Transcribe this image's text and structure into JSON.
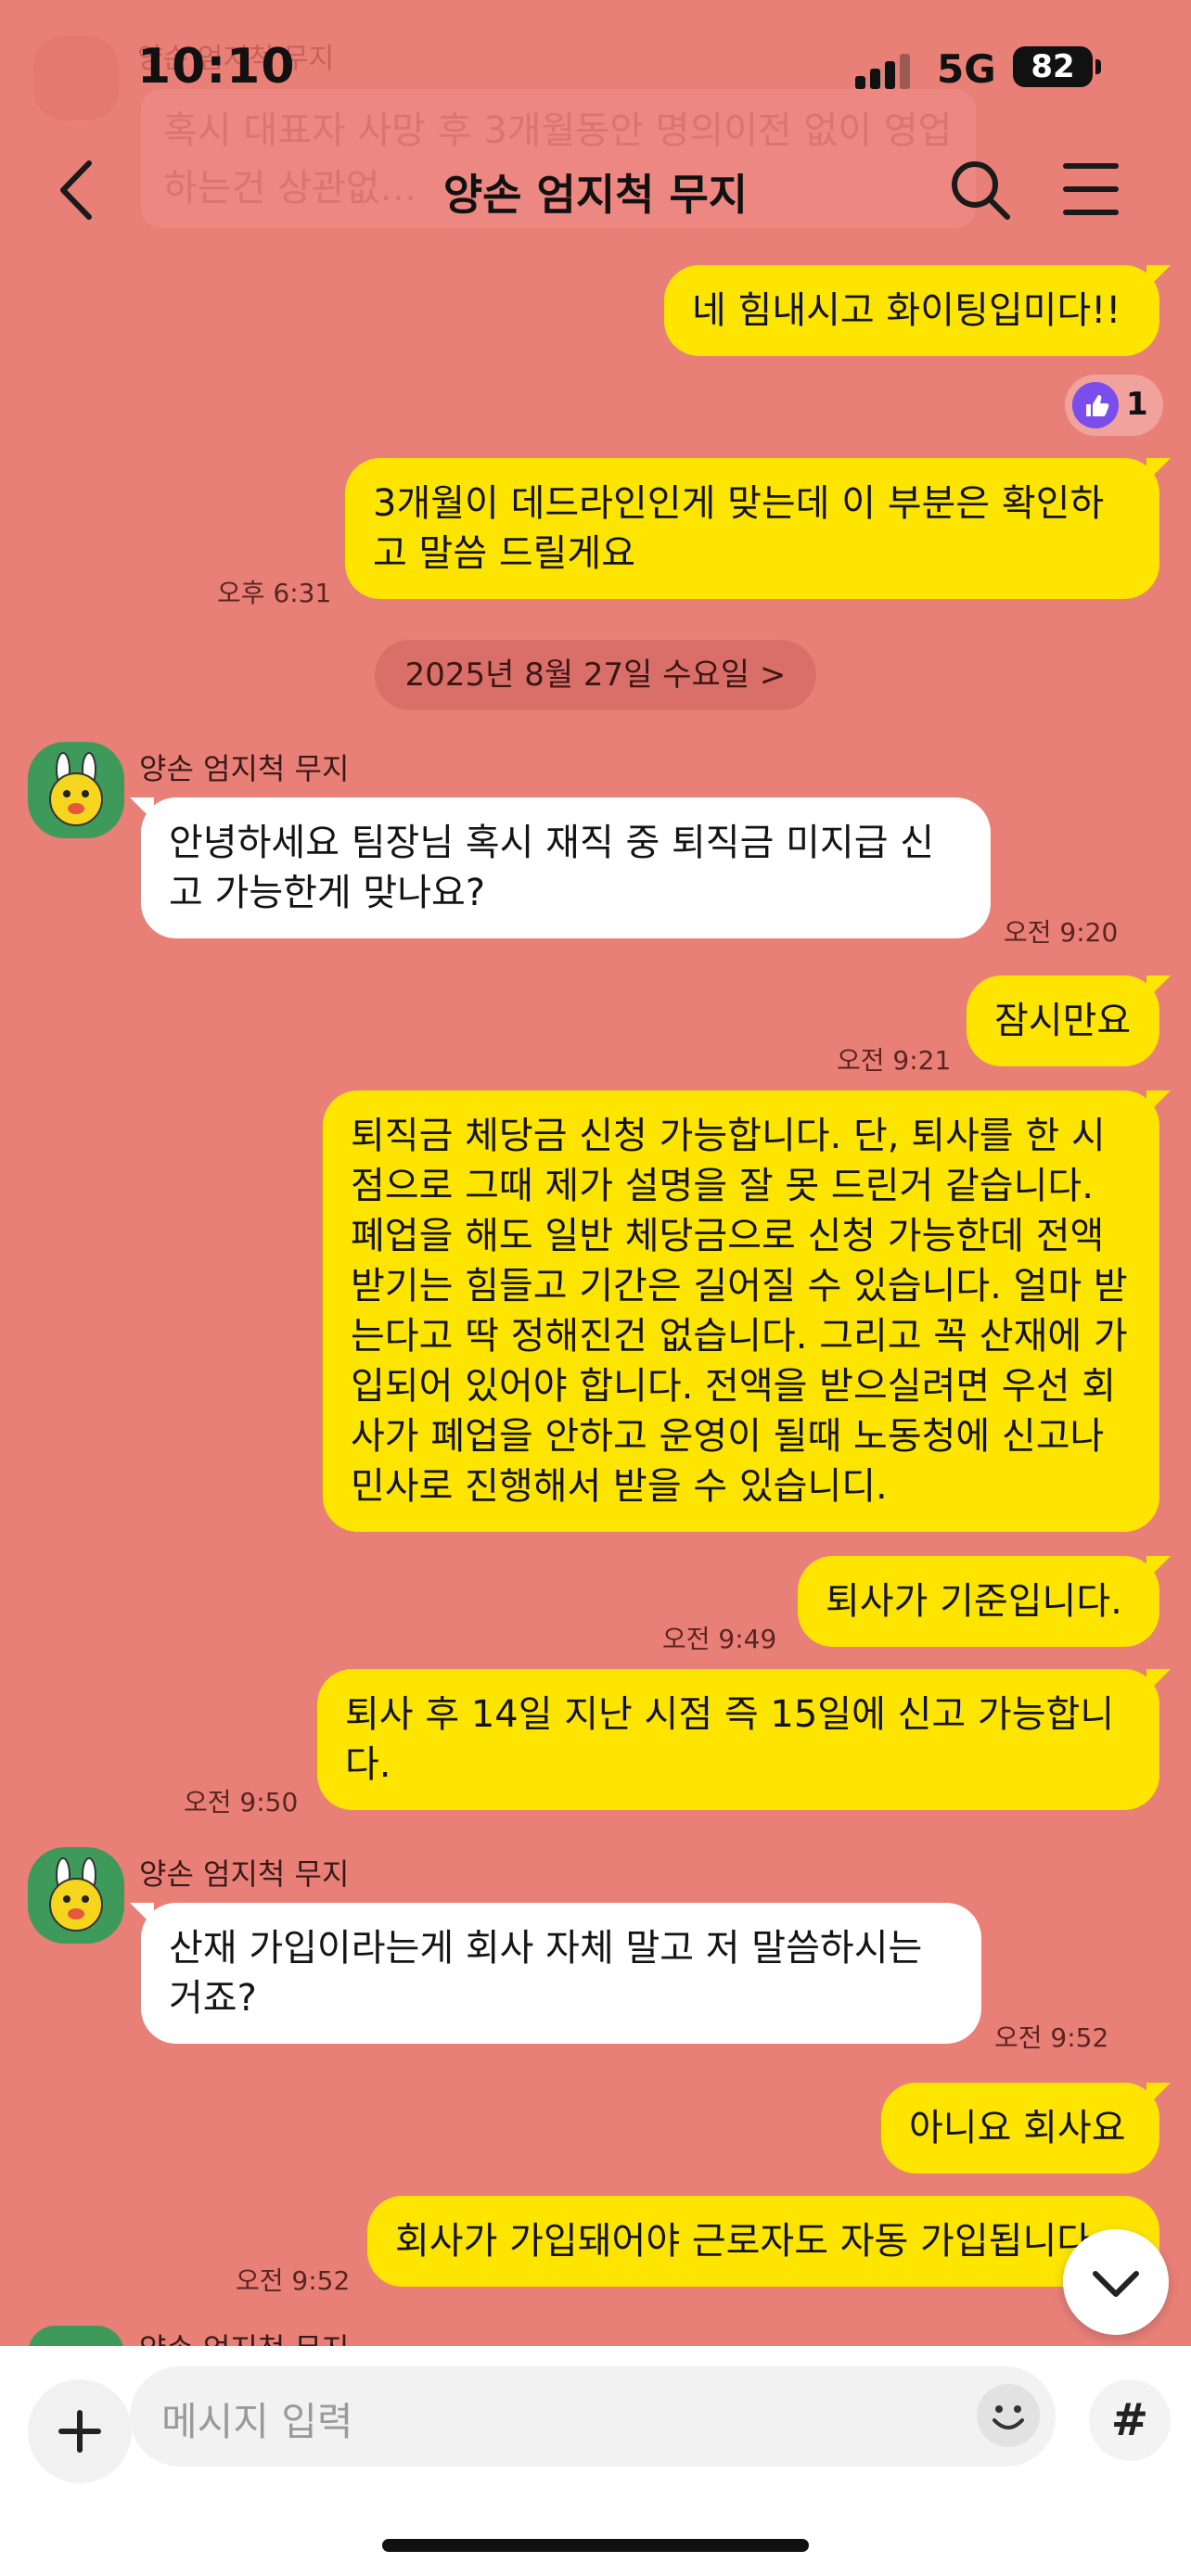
{
  "status": {
    "time": "10:10",
    "network": "5G",
    "battery": "82"
  },
  "pinned_notice": {
    "sender": "양손 엄지척 무지",
    "text": "혹시 대표자 사망 후 3개월동안 명의이전 없이 영업하는건 상관없…"
  },
  "header": {
    "title": "양손 엄지척 무지"
  },
  "reaction": {
    "count": "1"
  },
  "date_divider": "2025년 8월 27일 수요일 >",
  "messages": [
    {
      "from": "me",
      "text": "네 힘내시고 화이팅입미다!!",
      "time": ""
    },
    {
      "from": "me",
      "text": "3개월이 데드라인인게 맞는데 이 부분은 확인하고 말씀 드릴게요",
      "time": "오후 6:31"
    },
    {
      "from": "them",
      "sender": "양손 엄지척 무지",
      "text": "안녕하세요 팀장님 혹시 재직 중 퇴직금 미지급 신고 가능한게 맞나요?",
      "time": "오전 9:20"
    },
    {
      "from": "me",
      "text": "잠시만요",
      "time": "오전 9:21"
    },
    {
      "from": "me",
      "text": "퇴직금 체당금 신청 가능합니다. 단, 퇴사를 한 시점으로 그때 제가 설명을 잘 못 드린거 같습니다. 폐업을 해도 일반 체당금으로 신청 가능한데 전액 받기는 힘들고 기간은 길어질 수 있습니다. 얼마 받는다고 딱 정해진건 없습니다. 그리고 꼭 산재에 가입되어 있어야 합니다. 전액을 받으실려면 우선 회사가 폐업을 안하고 운영이 될때 노동청에 신고나 민사로 진행해서 받을 수 있습니디.",
      "time": ""
    },
    {
      "from": "me",
      "text": "퇴사가 기준입니다.",
      "time": "오전 9:49"
    },
    {
      "from": "me",
      "text": "퇴사 후 14일 지난 시점 즉 15일에 신고 가능합니다.",
      "time": "오전 9:50"
    },
    {
      "from": "them",
      "sender": "양손 엄지척 무지",
      "text": "산재 가입이라는게 회사 자체 말고 저 말씀하시는 거죠?",
      "time": "오전 9:52"
    },
    {
      "from": "me",
      "text": "아니요 회사요",
      "time": ""
    },
    {
      "from": "me",
      "text": "회사가 가입돼어야 근로자도 자동 가입됩니다",
      "time": "오전 9:52"
    },
    {
      "from": "them",
      "sender": "양손 엄지척 무지",
      "text": "",
      "time": ""
    }
  ],
  "input": {
    "placeholder": "메시지 입력"
  },
  "icons": {
    "back": "chevron-left-icon",
    "search": "search-icon",
    "menu": "hamburger-menu-icon",
    "plus": "plus-icon",
    "emoji": "emoji-icon",
    "hash": "hash-icon",
    "scroll": "chevron-down-icon"
  },
  "colors": {
    "background": "#E98078",
    "my_bubble": "#FEE500",
    "their_bubble": "#FFFFFF",
    "reaction": "#7B4DEA"
  }
}
